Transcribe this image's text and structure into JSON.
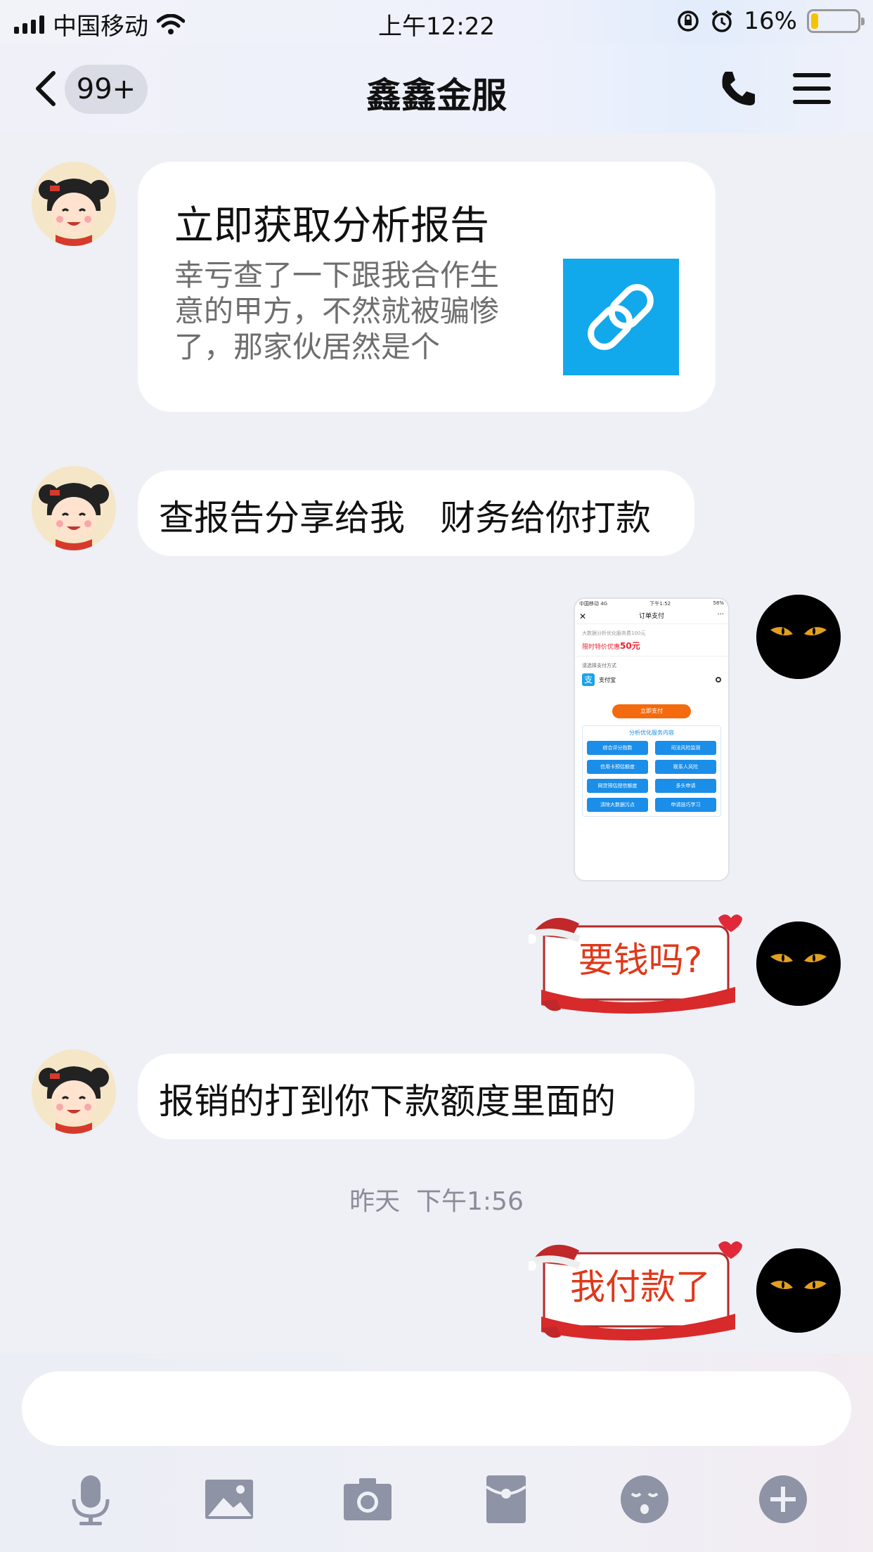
{
  "status_bar": {
    "carrier": "中国移动",
    "time": "上午12:22",
    "battery_percent": "16%",
    "battery_level": 0.16
  },
  "nav": {
    "unread_badge": "99+",
    "title": "鑫鑫金服",
    "back_icon": "chevron-left-icon",
    "call_icon": "phone-icon",
    "menu_icon": "menu-icon"
  },
  "messages": {
    "card": {
      "title": "立即获取分析报告",
      "desc_line1": "幸亏查了一下跟我合作生",
      "desc_line2": "意的甲方，不然就被骗惨",
      "desc_line3": "了，那家伙居然是个"
    },
    "msg2": "查报告分享给我　财务给你打款",
    "screenshot": {
      "carrier": "中国移动 4G",
      "time": "下午1:52",
      "battery": "58%",
      "title": "订单支付",
      "line1": "大数据分析优化服务费100元",
      "line2_prefix": "限时特价优惠",
      "line2_price": "50元",
      "line3": "请选择支付方式",
      "alipay_label": "支付宝",
      "pay_button": "立即支付",
      "box_title": "分析优化服务内容",
      "items": [
        "综合评分指数",
        "司法风险监测",
        "信用卡预估额度",
        "联系人风险",
        "网贷预估授信额度",
        "多头申请",
        "清除大数据污点",
        "申请技巧学习"
      ]
    },
    "sticker1": "要钱吗?",
    "msg4": "报销的打到你下款额度里面的",
    "timestamp": "昨天  下午1:56",
    "sticker2": "我付款了"
  },
  "input": {
    "placeholder": ""
  },
  "toolbar": {
    "icons": [
      "microphone-icon",
      "image-icon",
      "camera-icon",
      "red-packet-icon",
      "emoji-icon",
      "plus-icon"
    ]
  },
  "colors": {
    "accent_link": "#12a8ec",
    "sticker_text": "#e0381a",
    "pay_button": "#f46a0e"
  }
}
